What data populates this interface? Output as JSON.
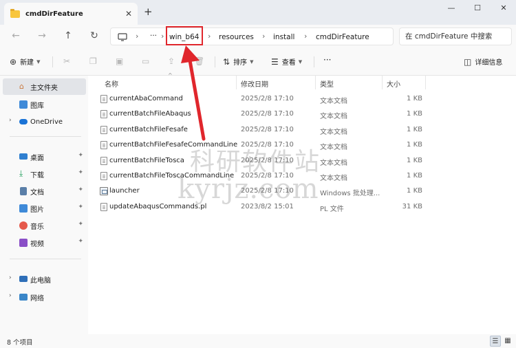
{
  "window": {
    "tab_title": "cmdDirFeature",
    "tab_close": "✕",
    "new_tab": "+",
    "minimize": "—",
    "maximize": "☐",
    "close": "✕"
  },
  "nav": {
    "back": "←",
    "forward": "→",
    "up": "↑",
    "refresh": "↻",
    "more": "···",
    "breadcrumb": [
      "win_b64",
      "resources",
      "install",
      "cmdDirFeature"
    ],
    "search_placeholder": "在 cmdDirFeature 中搜索"
  },
  "toolbar": {
    "new_label": "新建",
    "sort_label": "排序",
    "view_label": "查看",
    "more": "···",
    "details_label": "详细信息"
  },
  "sidebar": {
    "quick_access": "主文件夹",
    "gallery": "图库",
    "onedrive": "OneDrive",
    "pinned": [
      "桌面",
      "下载",
      "文档",
      "图片",
      "音乐",
      "视频"
    ],
    "this_pc": "此电脑",
    "network": "网络"
  },
  "columns": {
    "name": "名称",
    "modified": "修改日期",
    "type": "类型",
    "size": "大小"
  },
  "files": [
    {
      "name": "currentAbaCommand",
      "modified": "2025/2/8 17:10",
      "type": "文本文档",
      "size": "1 KB",
      "icon": "text-file-icon"
    },
    {
      "name": "currentBatchFileAbaqus",
      "modified": "2025/2/8 17:10",
      "type": "文本文档",
      "size": "1 KB",
      "icon": "text-file-icon"
    },
    {
      "name": "currentBatchFileFesafe",
      "modified": "2025/2/8 17:10",
      "type": "文本文档",
      "size": "1 KB",
      "icon": "text-file-icon"
    },
    {
      "name": "currentBatchFileFesafeCommandLine",
      "modified": "2025/2/8 17:10",
      "type": "文本文档",
      "size": "1 KB",
      "icon": "text-file-icon"
    },
    {
      "name": "currentBatchFileTosca",
      "modified": "2025/2/8 17:10",
      "type": "文本文档",
      "size": "1 KB",
      "icon": "text-file-icon"
    },
    {
      "name": "currentBatchFileToscaCommandLine",
      "modified": "2025/2/8 17:10",
      "type": "文本文档",
      "size": "1 KB",
      "icon": "text-file-icon"
    },
    {
      "name": "launcher",
      "modified": "2025/2/8 17:10",
      "type": "Windows 批处理...",
      "size": "1 KB",
      "icon": "batch-file-icon"
    },
    {
      "name": "updateAbaqusCommands.pl",
      "modified": "2023/8/2 15:01",
      "type": "PL 文件",
      "size": "31 KB",
      "icon": "text-file-icon"
    }
  ],
  "status": {
    "item_count": "8 个项目"
  },
  "watermark": {
    "line1": "科研软件站",
    "line2": "kyrjz.com"
  },
  "colors": {
    "highlight_red": "#e0262c",
    "folder_yellow": "#f8c63d",
    "selected_bg": "#e2e4e8"
  }
}
